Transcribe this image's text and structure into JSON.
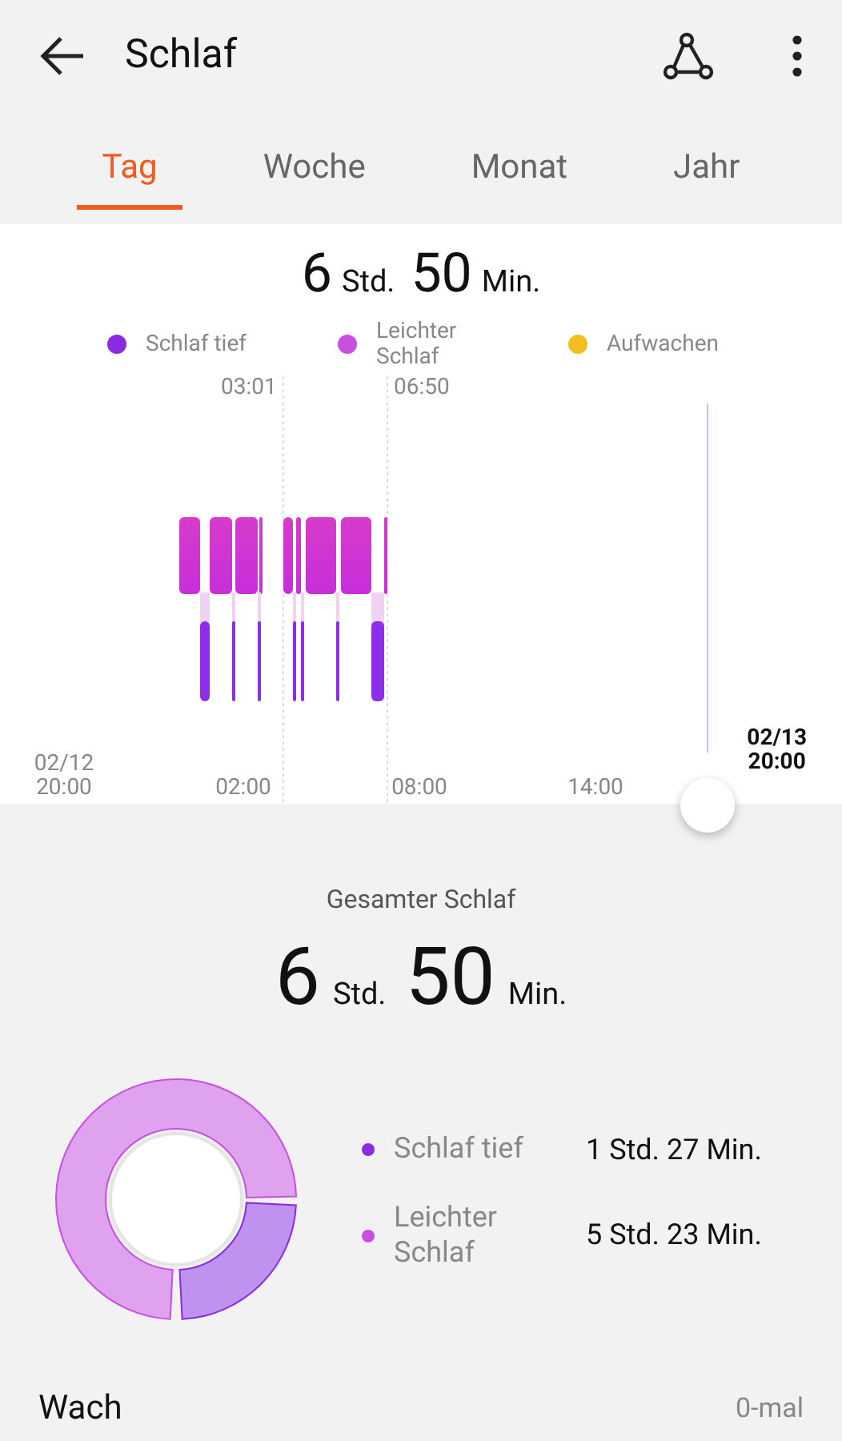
{
  "header": {
    "title": "Schlaf"
  },
  "tabs": [
    {
      "label": "Tag",
      "selected": true
    },
    {
      "label": "Woche",
      "selected": false
    },
    {
      "label": "Monat",
      "selected": false
    },
    {
      "label": "Jahr",
      "selected": false
    }
  ],
  "summary": {
    "hours": "6",
    "hours_unit": "Std.",
    "minutes": "50",
    "minutes_unit": "Min."
  },
  "legend": [
    {
      "label": "Schlaf tief",
      "color": "#8a2be2"
    },
    {
      "label": "Leichter Schlaf",
      "color": "#c84fe0"
    },
    {
      "label": "Aufwachen",
      "color": "#f5bd1f"
    }
  ],
  "timeline": {
    "markers": [
      "03:01",
      "06:50"
    ],
    "axis": [
      "02/12\n20:00",
      "02:00",
      "08:00",
      "14:00"
    ],
    "end_label": "02/13\n20:00"
  },
  "total": {
    "title": "Gesamter Schlaf",
    "hours": "6",
    "hours_unit": "Std.",
    "minutes": "50",
    "minutes_unit": "Min."
  },
  "breakdown": [
    {
      "label": "Schlaf tief",
      "value": "1 Std. 27 Min.",
      "color": "#8a2be2"
    },
    {
      "label": "Leichter Schlaf",
      "value": "5 Std. 23 Min.",
      "color": "#c84fe0"
    }
  ],
  "awake": {
    "label": "Wach",
    "value": "0-mal"
  }
}
